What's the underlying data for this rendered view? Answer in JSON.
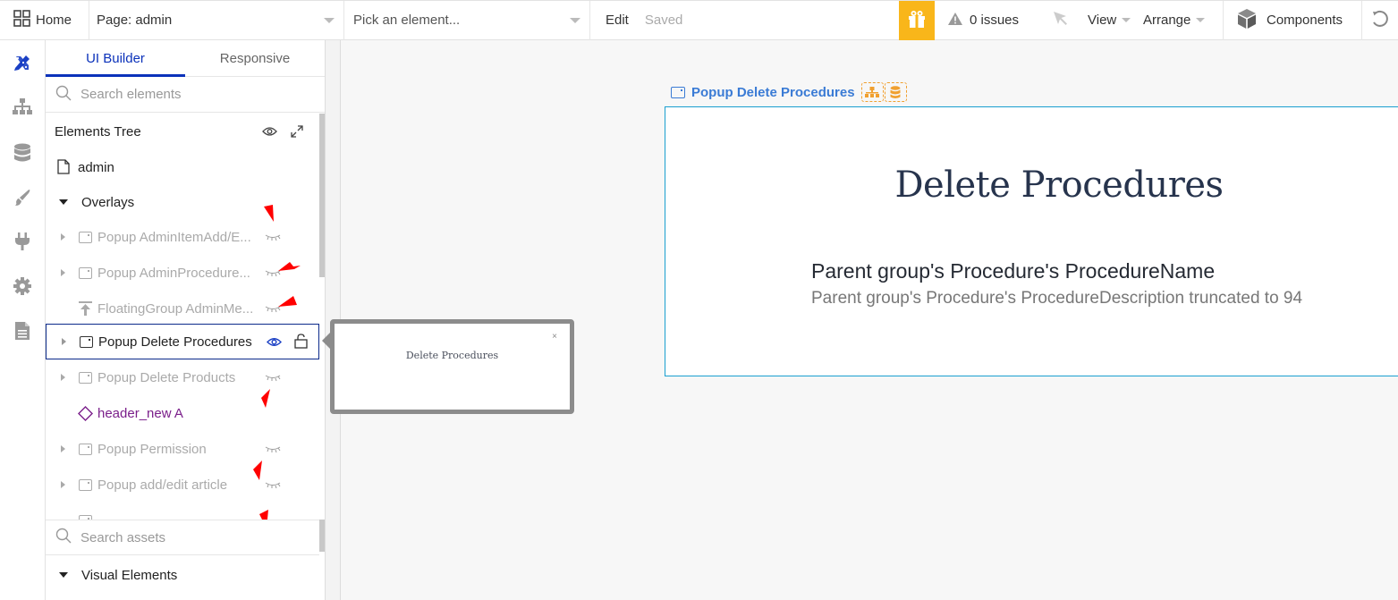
{
  "topbar": {
    "home_label": "Home",
    "page_select": "Page: admin",
    "element_picker_placeholder": "Pick an element...",
    "edit_label": "Edit",
    "save_status": "Saved",
    "issues_label": "0 issues",
    "view_label": "View",
    "arrange_label": "Arrange",
    "components_label": "Components",
    "gift_color": "#f9b61a"
  },
  "rail": {
    "icons": [
      "design-icon",
      "workflow-icon",
      "data-icon",
      "styles-icon",
      "plugins-icon",
      "settings-icon",
      "logs-icon"
    ]
  },
  "panel": {
    "tabs": [
      {
        "label": "UI Builder",
        "active": true
      },
      {
        "label": "Responsive",
        "active": false
      }
    ],
    "search_placeholder": "Search elements",
    "tree_title": "Elements Tree",
    "page_node": "admin",
    "group_label": "Overlays",
    "items": [
      {
        "label": "Popup AdminItemAdd/E...",
        "type": "popup",
        "hidden": true
      },
      {
        "label": "Popup AdminProcedure...",
        "type": "popup",
        "hidden": true
      },
      {
        "label": "FloatingGroup AdminMe...",
        "type": "floating-group",
        "hidden": true
      },
      {
        "label": "Popup Delete Procedures",
        "type": "popup",
        "hidden": false,
        "selected": true
      },
      {
        "label": "Popup Delete Products",
        "type": "popup",
        "hidden": true
      },
      {
        "label": "header_new A",
        "type": "reusable",
        "hidden": false
      },
      {
        "label": "Popup Permission",
        "type": "popup",
        "hidden": true
      },
      {
        "label": "Popup add/edit article",
        "type": "popup",
        "hidden": true
      }
    ],
    "assets_search_placeholder": "Search assets",
    "visual_elements_label": "Visual Elements"
  },
  "tooltip": {
    "title": "Delete Procedures",
    "close": "×"
  },
  "canvas": {
    "popup_label": "Popup Delete Procedures",
    "popup_title": "Delete Procedures",
    "procedure_name": "Parent group's Procedure's ProcedureName",
    "procedure_desc": "Parent group's Procedure's ProcedureDescription truncated to 94"
  }
}
